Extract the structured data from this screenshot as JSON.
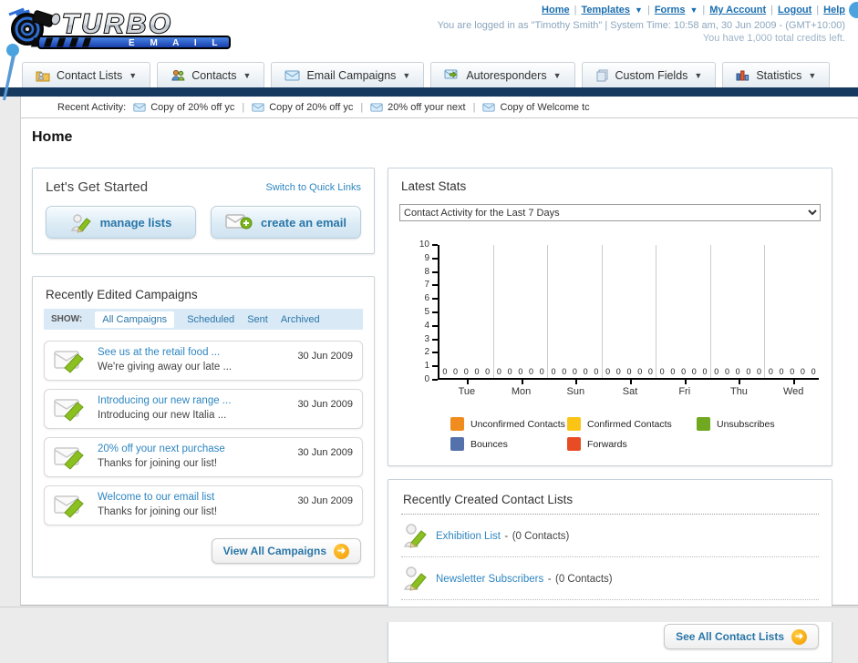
{
  "header": {
    "logo": {
      "title": "TURBO",
      "subtitle": "E M A I L"
    },
    "links": [
      "Home",
      "Templates",
      "Forms",
      "My Account",
      "Logout",
      "Help"
    ],
    "login_info": "You are logged in as \"Timothy Smith\" | System Time: 10:58 am, 30 Jun 2009 - (GMT+10:00)",
    "credits": "You have 1,000 total credits left."
  },
  "nav": {
    "tabs": [
      {
        "label": "Contact Lists"
      },
      {
        "label": "Contacts"
      },
      {
        "label": "Email Campaigns"
      },
      {
        "label": "Autoresponders"
      },
      {
        "label": "Custom Fields"
      },
      {
        "label": "Statistics"
      }
    ]
  },
  "recent_activity": {
    "label": "Recent Activity:",
    "items": [
      "Copy of 20% off yc",
      "Copy of 20% off yc",
      "20% off your next",
      "Copy of Welcome tc"
    ]
  },
  "page": {
    "title": "Home"
  },
  "get_started": {
    "title": "Let's Get Started",
    "switch_link": "Switch to Quick Links",
    "buttons": [
      {
        "label": "manage lists"
      },
      {
        "label": "create an email"
      }
    ]
  },
  "campaigns": {
    "title": "Recently Edited Campaigns",
    "show_label": "SHOW:",
    "filters": [
      "All Campaigns",
      "Scheduled",
      "Sent",
      "Archived"
    ],
    "active_filter": "All Campaigns",
    "items": [
      {
        "title": "See us at the retail food ...",
        "subtitle": "We're giving away our late ...",
        "date": "30 Jun 2009"
      },
      {
        "title": "Introducing our new range ...",
        "subtitle": "Introducing our new Italia ...",
        "date": "30 Jun 2009"
      },
      {
        "title": "20% off your next purchase",
        "subtitle": "Thanks for joining our list!",
        "date": "30 Jun 2009"
      },
      {
        "title": "Welcome to our email list",
        "subtitle": "Thanks for joining our list!",
        "date": "30 Jun 2009"
      }
    ],
    "view_all": "View All Campaigns"
  },
  "stats": {
    "title": "Latest Stats",
    "dropdown": "Contact Activity for the Last 7 Days"
  },
  "chart_data": {
    "type": "bar",
    "title": "Contact Activity for the Last 7 Days",
    "categories": [
      "Tue",
      "Mon",
      "Sun",
      "Sat",
      "Fri",
      "Thu",
      "Wed"
    ],
    "series": [
      {
        "name": "Unconfirmed Contacts",
        "color": "#f08c1e",
        "values": [
          0,
          0,
          0,
          0,
          0,
          0,
          0
        ]
      },
      {
        "name": "Confirmed Contacts",
        "color": "#fcc515",
        "values": [
          0,
          0,
          0,
          0,
          0,
          0,
          0
        ]
      },
      {
        "name": "Unsubscribes",
        "color": "#70a820",
        "values": [
          0,
          0,
          0,
          0,
          0,
          0,
          0
        ]
      },
      {
        "name": "Bounces",
        "color": "#5571ab",
        "values": [
          0,
          0,
          0,
          0,
          0,
          0,
          0
        ]
      },
      {
        "name": "Forwards",
        "color": "#e84c25",
        "values": [
          0,
          0,
          0,
          0,
          0,
          0,
          0
        ]
      }
    ],
    "ylim": [
      0,
      10
    ],
    "yticks": [
      0,
      1,
      2,
      3,
      4,
      5,
      6,
      7,
      8,
      9,
      10
    ],
    "grid": "vertical-group-separators",
    "legend_position": "bottom",
    "value_labels_shown": true
  },
  "contact_lists": {
    "title": "Recently Created Contact Lists",
    "items": [
      {
        "name": "Exhibition List",
        "sep": "-",
        "count": "(0 Contacts)"
      },
      {
        "name": "Newsletter Subscribers",
        "sep": "-",
        "count": "(0 Contacts)"
      }
    ],
    "see_all": "See All Contact Lists"
  }
}
